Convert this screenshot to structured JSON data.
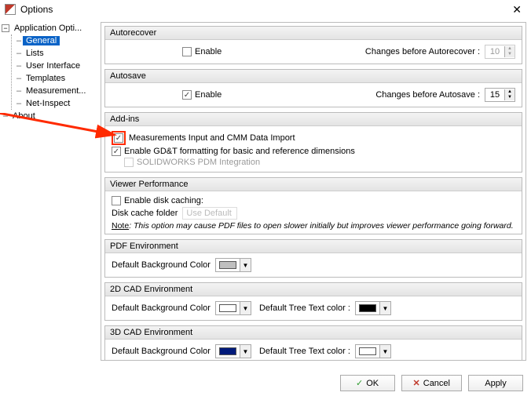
{
  "window": {
    "title": "Options"
  },
  "tree": {
    "root": "Application Opti...",
    "items": [
      "General",
      "Lists",
      "User Interface",
      "Templates",
      "Measurement...",
      "Net-Inspect"
    ],
    "about": "About",
    "selected": 0
  },
  "autorecover": {
    "title": "Autorecover",
    "enable_label": "Enable",
    "enable_checked": false,
    "changes_label": "Changes before Autorecover :",
    "changes_value": "10",
    "changes_disabled": true
  },
  "autosave": {
    "title": "Autosave",
    "enable_label": "Enable",
    "enable_checked": true,
    "changes_label": "Changes before Autosave :",
    "changes_value": "15"
  },
  "addins": {
    "title": "Add-ins",
    "items": [
      {
        "label": "Measurements Input and CMM Data Import",
        "checked": true,
        "highlighted": true
      },
      {
        "label": "Enable GD&T formatting for basic and reference dimensions",
        "checked": true
      },
      {
        "label": "SOLIDWORKS PDM Integration",
        "checked": false,
        "disabled": true
      }
    ]
  },
  "viewer": {
    "title": "Viewer Performance",
    "enable_cache_label": "Enable disk caching:",
    "enable_cache_checked": false,
    "folder_label": "Disk cache folder",
    "folder_placeholder": "Use Default",
    "note_prefix": "Note",
    "note_text": ": This option may cause PDF files to open slower initially but improves viewer performance going forward."
  },
  "pdf_env": {
    "title": "PDF Environment",
    "bg_label": "Default Background Color",
    "bg_color": "#bfbfbf"
  },
  "cad2d": {
    "title": "2D CAD Environment",
    "bg_label": "Default Background Color",
    "bg_color": "#ffffff",
    "tree_label": "Default Tree Text color :",
    "tree_color": "#000000"
  },
  "cad3d": {
    "title": "3D CAD Environment",
    "bg_label": "Default Background Color",
    "bg_color": "#001a7a",
    "tree_label": "Default Tree Text color :",
    "tree_color": "#ffffff"
  },
  "buttons": {
    "ok": "OK",
    "cancel": "Cancel",
    "apply": "Apply"
  }
}
